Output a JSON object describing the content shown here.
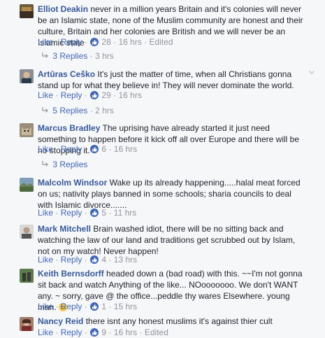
{
  "actions": {
    "like": "Like",
    "reply": "Reply",
    "dot": "·"
  },
  "comments": [
    {
      "author": "Elliot Deakin",
      "text": "never in a million years Britain and it's colonies will never be an Islamic state, none of the Muslim community are honest and their culture, Britain and her colonies are British and we will never be an Islamic state",
      "likes": "28",
      "time": "16 hrs",
      "edited": "Edited",
      "replies_label": "3 Replies",
      "replies_time": "3 hrs"
    },
    {
      "author": "Artūras Ceško",
      "text": "It's just the matter of time, when all Christians gonna stand up for what they believe in! They will never dominate the world.",
      "likes": "29",
      "time": "16 hrs",
      "replies_label": "5 Replies",
      "replies_time": "2 hrs"
    },
    {
      "author": "Marcus Bradley",
      "text": "The uprising have already started it just need something to happen before it kick off all over Europe and there will be no stopping it.",
      "likes": "6",
      "time": "16 hrs",
      "replies_label": "3 Replies"
    },
    {
      "author": "Malcolm Windsor",
      "text": "Wake up its already happening.....halal meat forced on us; nativity plays banned in some schools; sharia councils to deal with Islamic divorce.......",
      "likes": "5",
      "time": "11 hrs"
    },
    {
      "author": "Mark Mitchell",
      "text": "Brain washed idiot, there will be no sitting back and watching the law of our land and traditions get scrubbed out by Islam, not on my watch! Never happen!",
      "likes": "4",
      "time": "13 hrs"
    },
    {
      "author": "Keith Bernsdorff",
      "text": "headed down a (bad road) with this. ~~I'm not gonna sit back and watch Anything of the like... NOooooooo. We don't WANT any. ~ sorry, gave @ the office...peddle thy wares Elsewhere. young man.",
      "likes": "1",
      "time": "15 hrs"
    },
    {
      "author": "Nancy Reid",
      "text": "there isnt any honest muslims it's against thier cult",
      "likes": "9",
      "time": "16 hrs",
      "edited": "Edited"
    }
  ],
  "colors": {
    "link": "#4267b2",
    "name": "#365899",
    "meta": "#90949c",
    "background": "#f6f7f9"
  }
}
